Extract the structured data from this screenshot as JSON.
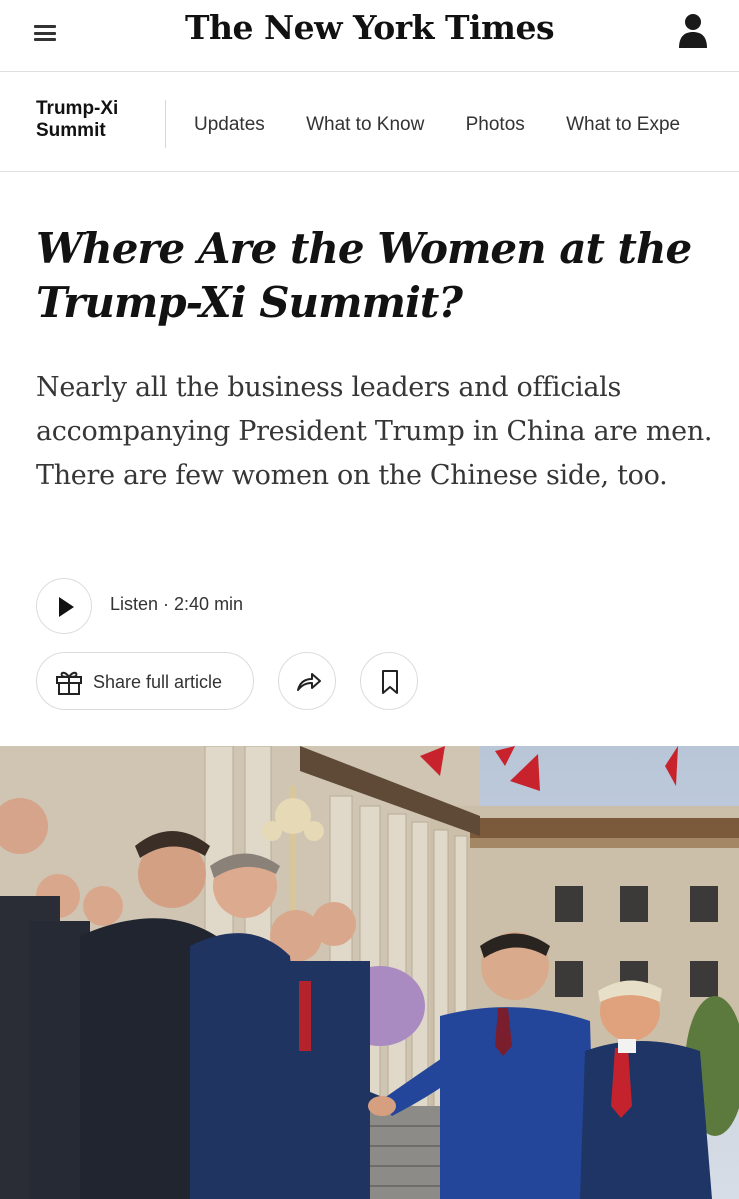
{
  "masthead": {
    "logo": "The New York Times",
    "menu_icon": "hamburger-menu-icon",
    "account_icon": "user-icon"
  },
  "section_nav": {
    "title_line1": "Trump-Xi",
    "title_line2": "Summit",
    "links": [
      "Updates",
      "What to Know",
      "Photos",
      "What to Expe"
    ]
  },
  "article": {
    "headline": "Where Are the Women at the Trump-Xi Summit?",
    "dek": "Nearly all the business leaders and officials accompanying President Trump in China are men. There are few women on the Chinese side, too.",
    "listen_label": "Listen · 2:40 min",
    "share_label": "Share full article",
    "share_icon": "gift-icon",
    "forward_icon": "share-arrow-icon",
    "save_icon": "bookmark-icon"
  },
  "colors": {
    "text": "#121212",
    "border": "#dcdcdc",
    "suit_navy": "#1f3461",
    "tie_red": "#b4232c"
  }
}
